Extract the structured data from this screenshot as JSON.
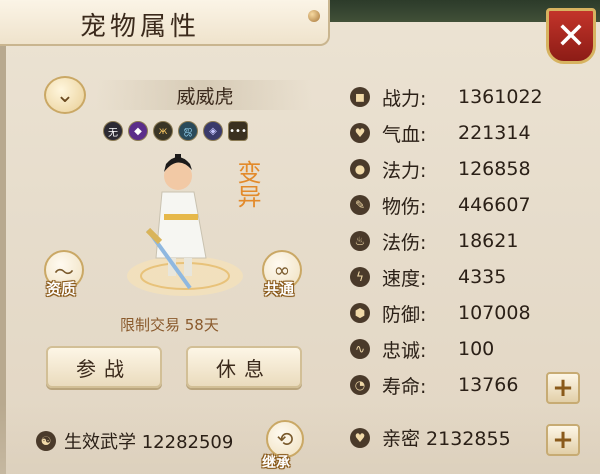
{
  "window": {
    "title": "宠物属性",
    "close_label": "✕"
  },
  "pet": {
    "name": "威威虎",
    "transform_label": "变异",
    "trade_limit": "限制交易 58天",
    "skills": [
      "无",
      "◆",
      "ж",
      "ஜ",
      "◈",
      "•••"
    ]
  },
  "side_buttons": {
    "aptitude": "资质",
    "common": "共通",
    "inherit": "继承"
  },
  "actions": {
    "battle": "参战",
    "rest": "休息"
  },
  "martial": {
    "label": "生效武学 12282509"
  },
  "stats": [
    {
      "icon": "power-icon",
      "glyph": "◼",
      "label": "战力:",
      "value": "1361022"
    },
    {
      "icon": "hp-icon",
      "glyph": "♥",
      "label": "气血:",
      "value": "221314"
    },
    {
      "icon": "mana-icon",
      "glyph": "●",
      "label": "法力:",
      "value": "126858"
    },
    {
      "icon": "physical-damage-icon",
      "glyph": "✎",
      "label": "物伤:",
      "value": "446607"
    },
    {
      "icon": "magic-damage-icon",
      "glyph": "♨",
      "label": "法伤:",
      "value": "18621"
    },
    {
      "icon": "speed-icon",
      "glyph": "ϟ",
      "label": "速度:",
      "value": "4335"
    },
    {
      "icon": "defense-icon",
      "glyph": "⬢",
      "label": "防御:",
      "value": "107008"
    },
    {
      "icon": "loyalty-icon",
      "glyph": "∿",
      "label": "忠诚:",
      "value": "100"
    },
    {
      "icon": "lifespan-icon",
      "glyph": "◔",
      "label": "寿命:",
      "value": "13766"
    }
  ],
  "intimacy": {
    "label": "亲密 2132855"
  }
}
